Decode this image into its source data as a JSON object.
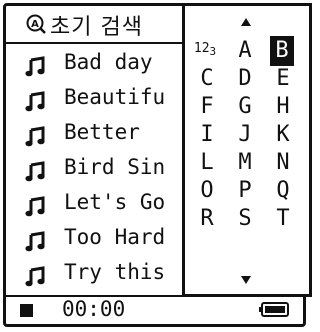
{
  "header": {
    "title": "초기 검색",
    "search_icon": "search-magnifier-a-icon"
  },
  "songs": [
    {
      "title": "Bad day",
      "icon": "music-note-icon"
    },
    {
      "title": "Beautifu",
      "icon": "music-note-icon"
    },
    {
      "title": "Better",
      "icon": "music-note-icon"
    },
    {
      "title": "Bird Sin",
      "icon": "music-note-icon"
    },
    {
      "title": "Let's Go",
      "icon": "music-note-icon"
    },
    {
      "title": "Too Hard",
      "icon": "music-note-icon"
    },
    {
      "title": "Try this",
      "icon": "music-note-icon"
    }
  ],
  "alpha_index": {
    "numeric_label": "1",
    "numeric_label_mid": "2",
    "numeric_label_sub": "3",
    "letters": [
      "A",
      "B",
      "C",
      "D",
      "E",
      "F",
      "G",
      "H",
      "I",
      "J",
      "K",
      "L",
      "M",
      "N",
      "O",
      "P",
      "Q",
      "R",
      "S",
      "T"
    ],
    "selected": "B"
  },
  "status": {
    "state_icon": "stop-icon",
    "time": "00:00",
    "battery_icon": "battery-full-icon"
  }
}
